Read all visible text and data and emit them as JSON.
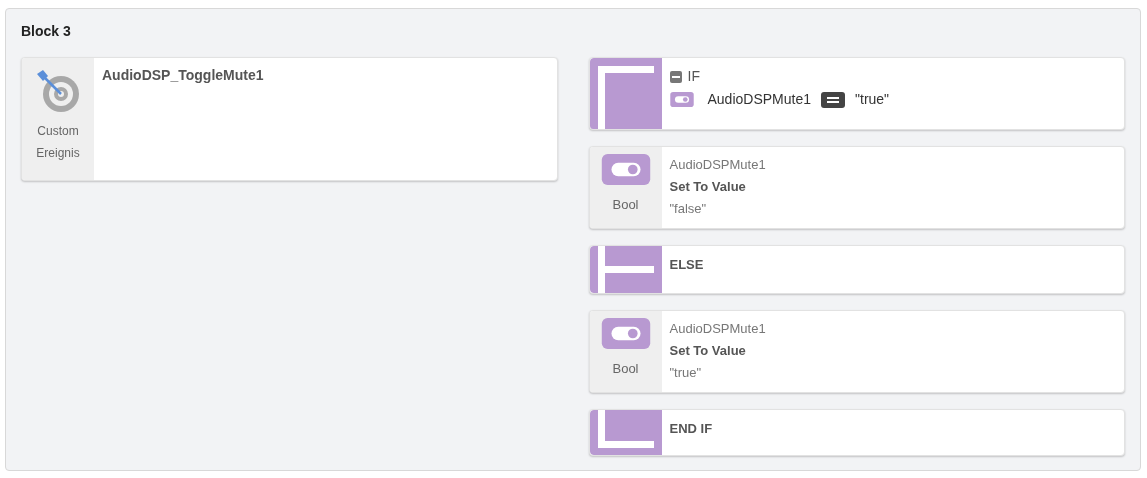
{
  "block": {
    "title": "Block 3"
  },
  "trigger": {
    "name": "AudioDSP_ToggleMute1",
    "type_label": "Custom Ereignis"
  },
  "steps": [
    {
      "kind": "if",
      "label": "IF",
      "condition": {
        "variable": "AudioDSPMute1",
        "value": "\"true\""
      }
    },
    {
      "kind": "set",
      "type_label": "Bool",
      "variable": "AudioDSPMute1",
      "action": "Set To Value",
      "value": "\"false\""
    },
    {
      "kind": "else",
      "label": "ELSE"
    },
    {
      "kind": "set",
      "type_label": "Bool",
      "variable": "AudioDSPMute1",
      "action": "Set To Value",
      "value": "\"true\""
    },
    {
      "kind": "endif",
      "label": "END IF"
    }
  ]
}
